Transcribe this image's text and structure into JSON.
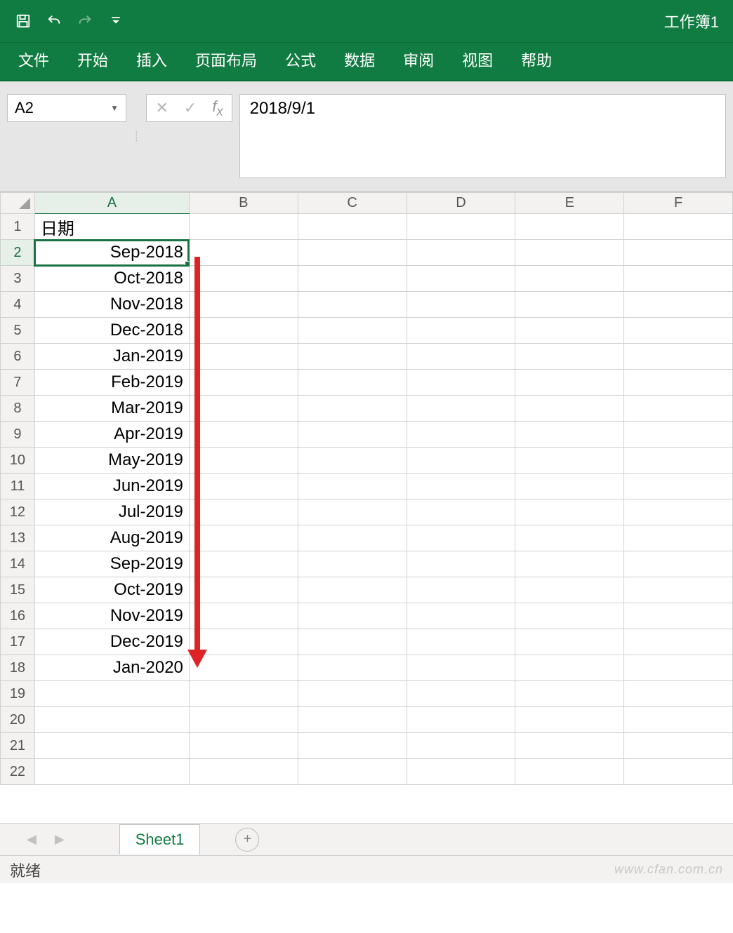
{
  "window": {
    "title": "工作簿1"
  },
  "ribbon": {
    "tabs": [
      "文件",
      "开始",
      "插入",
      "页面布局",
      "公式",
      "数据",
      "审阅",
      "视图",
      "帮助"
    ]
  },
  "formula_bar": {
    "name_box": "A2",
    "formula_value": "2018/9/1"
  },
  "columns": [
    "A",
    "B",
    "C",
    "D",
    "E",
    "F"
  ],
  "rows": [
    {
      "num": "1",
      "A": "日期",
      "align": "left"
    },
    {
      "num": "2",
      "A": "Sep-2018",
      "selected": true
    },
    {
      "num": "3",
      "A": "Oct-2018"
    },
    {
      "num": "4",
      "A": "Nov-2018"
    },
    {
      "num": "5",
      "A": "Dec-2018"
    },
    {
      "num": "6",
      "A": "Jan-2019"
    },
    {
      "num": "7",
      "A": "Feb-2019"
    },
    {
      "num": "8",
      "A": "Mar-2019"
    },
    {
      "num": "9",
      "A": "Apr-2019"
    },
    {
      "num": "10",
      "A": "May-2019"
    },
    {
      "num": "11",
      "A": "Jun-2019"
    },
    {
      "num": "12",
      "A": "Jul-2019"
    },
    {
      "num": "13",
      "A": "Aug-2019"
    },
    {
      "num": "14",
      "A": "Sep-2019"
    },
    {
      "num": "15",
      "A": "Oct-2019"
    },
    {
      "num": "16",
      "A": "Nov-2019"
    },
    {
      "num": "17",
      "A": "Dec-2019"
    },
    {
      "num": "18",
      "A": "Jan-2020"
    },
    {
      "num": "19",
      "A": ""
    },
    {
      "num": "20",
      "A": ""
    },
    {
      "num": "21",
      "A": ""
    },
    {
      "num": "22",
      "A": ""
    }
  ],
  "sheet_tabs": {
    "active": "Sheet1"
  },
  "statusbar": {
    "ready": "就绪",
    "watermark": "www.cfan.com.cn"
  }
}
